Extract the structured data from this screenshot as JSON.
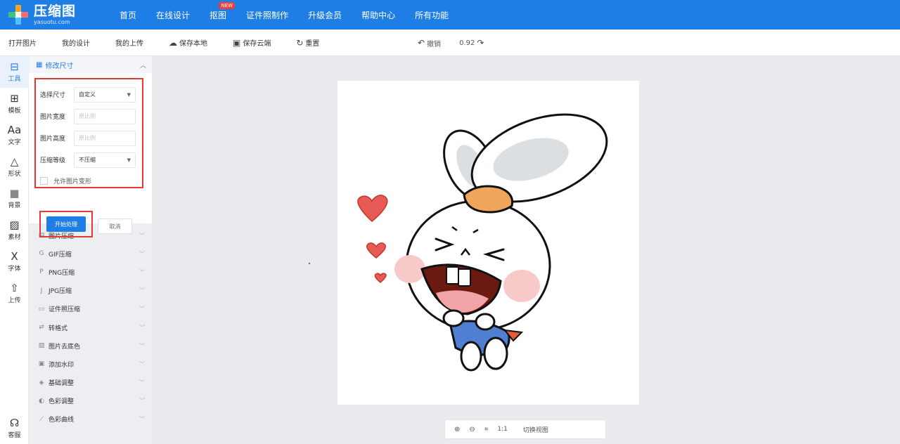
{
  "app": {
    "logo_title": "压缩图",
    "logo_sub": "yasuotu.com"
  },
  "nav": {
    "items": [
      "首页",
      "在线设计",
      "抠图",
      "证件照制作",
      "升级会员",
      "帮助中心",
      "所有功能"
    ],
    "new_badge": "NEW"
  },
  "toolbar": {
    "open": "打开图片",
    "my_designs": "我的设计",
    "my_uploads": "我的上传",
    "save_local": "保存本地",
    "save_cloud": "保存云端",
    "reset": "重置",
    "undo": "撤销",
    "redo": "0.92"
  },
  "rail": {
    "items": [
      "工具",
      "模板",
      "文字",
      "形状",
      "背景",
      "素材",
      "字体",
      "上传"
    ],
    "bottom": "客服"
  },
  "panel": {
    "header": "修改尺寸",
    "size_label": "选择尺寸",
    "size_value": "自定义",
    "width_label": "图片宽度",
    "width_placeholder": "原比例",
    "height_label": "图片高度",
    "height_placeholder": "原比例",
    "compress_label": "压缩等级",
    "compress_value": "不压缩",
    "allow_deform": "允许图片变形",
    "start": "开始处理",
    "cancel": "取消"
  },
  "tools": [
    "图片压缩",
    "GIF压缩",
    "PNG压缩",
    "JPG压缩",
    "证件照压缩",
    "转格式",
    "图片去底色",
    "添加水印",
    "基础调整",
    "色彩调整",
    "色彩曲线"
  ],
  "zoom": {
    "ratio": "1:1",
    "switch_view": "切换视图"
  },
  "colors": {
    "primary": "#1f7ee6",
    "highlight": "#e53935",
    "canvas_bg": "#e9ebee"
  }
}
